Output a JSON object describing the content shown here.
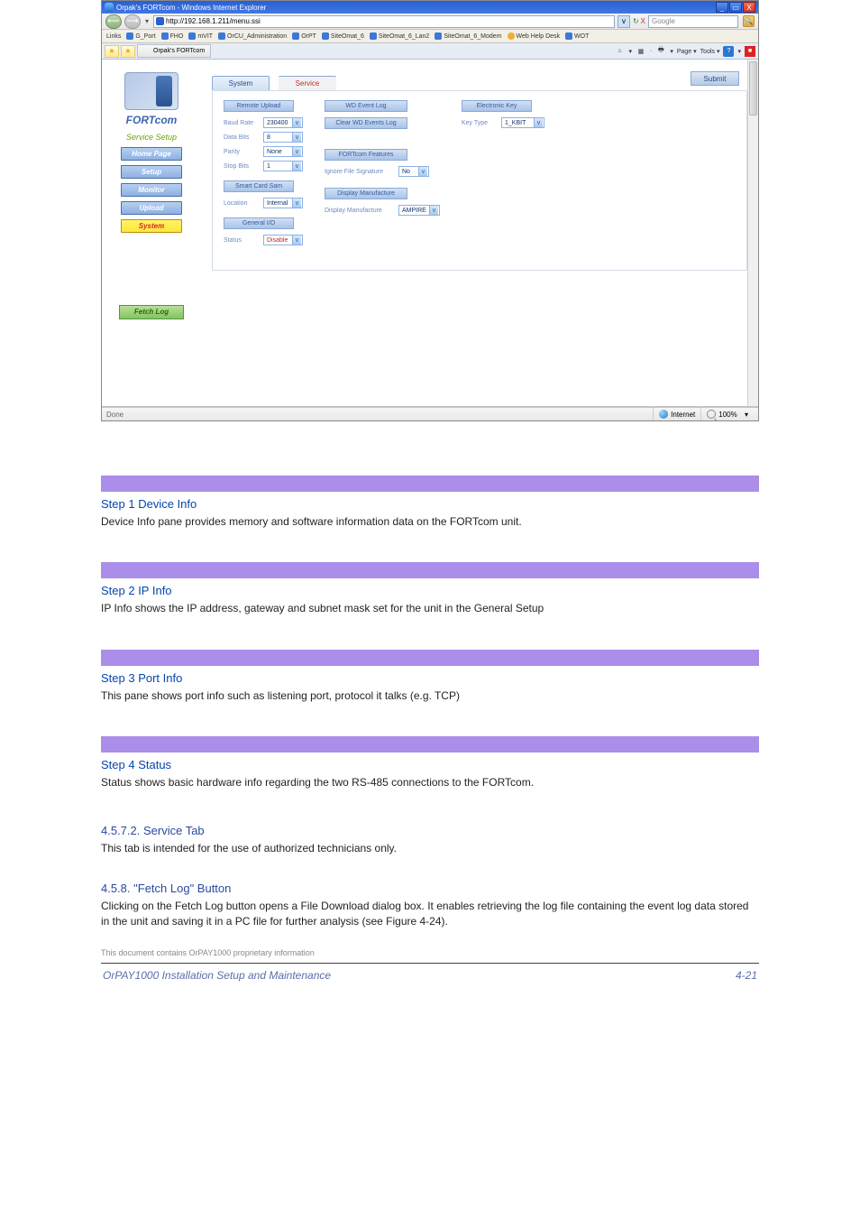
{
  "browser": {
    "title": "Orpak's FORTcom - Windows Internet Explorer",
    "win_controls": {
      "min": "_",
      "max": "▭",
      "close": "X"
    },
    "nav": {
      "back": "⟵",
      "fwd": "⟶",
      "dropdown": "▾"
    },
    "address_url": "http://192.168.1.211/menu.ssi",
    "addr_go": "v",
    "search": {
      "placeholder": "Google",
      "reload": "↻",
      "x": "X",
      "mag": "🔍"
    },
    "links_label": "Links",
    "links": [
      "G_Port",
      "FHO",
      "mVIT",
      "OrCU_Administration",
      "OrPT",
      "SiteOmat_6",
      "SiteOmat_6_Lan2",
      "SiteOmat_6_Modem",
      "Web Help Desk",
      "WOT"
    ],
    "fav_star": "★",
    "tab_label": "Orpak's FORTcom",
    "cmdbar": {
      "home": "⌂",
      "dd": "▾",
      "feed": "▦",
      "print": "🖶",
      "page": "Page",
      "tools": "Tools",
      "help": "?",
      "red": "■"
    }
  },
  "sidebar": {
    "brand": "FORTcom",
    "service_title": "Service Setup",
    "buttons": {
      "home": "Home Page",
      "setup": "Setup",
      "monitor": "Monitor",
      "upload": "Upload",
      "system": "System"
    },
    "fetch": "Fetch Log"
  },
  "panel": {
    "tabs": {
      "system": "System",
      "service": "Service"
    },
    "submit": "Submit",
    "remote_upload": {
      "title": "Remote Upload",
      "baud_label": "Baud Rate",
      "baud": "230400",
      "data_label": "Data Bits",
      "data": "8",
      "parity_label": "Parity",
      "parity": "None",
      "stop_label": "Stop Bits",
      "stop": "1"
    },
    "smart_card": {
      "title": "Smart Card Sam",
      "loc_label": "Location",
      "loc": "Internal"
    },
    "general_io": {
      "title": "General I/O",
      "status_label": "Status",
      "status": "Disable"
    },
    "wd_event": {
      "title": "WD Event Log",
      "clear": "Clear WD Events Log"
    },
    "fortcom_feat": {
      "title": "FORTcom Features",
      "ignore_label": "Ignore File Signature",
      "ignore": "No"
    },
    "display_mfr": {
      "title": "Display Manufacture",
      "label": "Display Manufacture",
      "value": "AMPIRE"
    },
    "ekey": {
      "title": "Electronic Key",
      "type_label": "Key Type",
      "type": "1_KBIT"
    }
  },
  "statusbar": {
    "done": "Done",
    "zone": "Internet",
    "zoom": "100%",
    "dd": "▾"
  },
  "doc": {
    "steps": [
      {
        "head": "Step 1 Device Info",
        "body": "Device Info pane provides memory and software information data on the FORTcom unit."
      },
      {
        "head": "Step 2 IP Info",
        "body": "IP Info shows the IP address, gateway and subnet mask set for the unit in the General Setup "
      },
      {
        "head": "Step 3 Port Info",
        "body": "This pane shows port info such as listening port, protocol it talks (e.g. TCP)"
      },
      {
        "head": "Step 4 Status",
        "body": "Status shows basic hardware info regarding the two RS-485 connections to the FORTcom."
      }
    ],
    "sub1_title": "4.5.7.2. Service Tab",
    "sub1_text": "This tab is intended for the use of authorized technicians only.",
    "sub2_title": "4.5.8. \"Fetch Log\" Button",
    "sub2_text": "Clicking on the Fetch Log button opens a File Download dialog box. It enables retrieving the log file containing the event log data stored in the unit and saving it in a PC file for further analysis (see Figure 4-24).",
    "note": "This document contains OrPAY1000 proprietary information",
    "footer_left": "OrPAY1000 Installation Setup and Maintenance",
    "footer_right": "4-21"
  },
  "dd_glyph": "v"
}
